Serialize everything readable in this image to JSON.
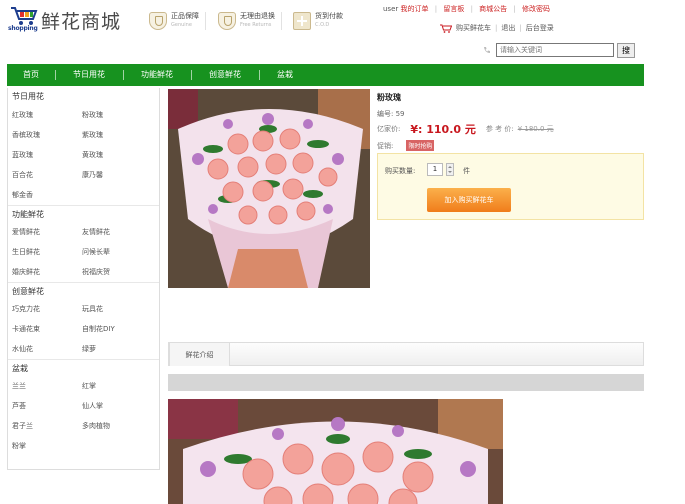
{
  "logo": {
    "title": "鲜花商城",
    "subtitle": "shopping"
  },
  "guarantees": [
    {
      "title": "正品保障",
      "subtitle": "Genuine"
    },
    {
      "title": "无理由退换",
      "subtitle": "Free Returns"
    },
    {
      "title": "货到付款",
      "subtitle": "C.O.D"
    }
  ],
  "top_links": {
    "user": "user",
    "my_orders": "我的订单",
    "message_board": "留言板",
    "mall_notice": "商城公告",
    "change_password": "修改密码"
  },
  "cart_line": {
    "cart": "购买鲜花车",
    "logout": "退出",
    "admin_login": "后台登录"
  },
  "search": {
    "placeholder": "请输入关键词",
    "button": "搜"
  },
  "nav": [
    "首页",
    "节日用花",
    "功能鲜花",
    "创意鲜花",
    "盆栽"
  ],
  "sidebar": [
    {
      "title": "节日用花",
      "items": [
        "红玫瑰",
        "粉玫瑰",
        "香槟玫瑰",
        "紫玫瑰",
        "蓝玫瑰",
        "黄玫瑰",
        "百合花",
        "康乃馨",
        "郁金香"
      ]
    },
    {
      "title": "功能鲜花",
      "items": [
        "爱情鲜花",
        "友情鲜花",
        "生日鲜花",
        "问候长辈",
        "婚庆鲜花",
        "祝福庆贺"
      ]
    },
    {
      "title": "创意鲜花",
      "items": [
        "巧克力花",
        "玩具花",
        "卡通花束",
        "自制花DIY",
        "水仙花",
        "绿萝"
      ]
    },
    {
      "title": "盆栽",
      "items": [
        "兰兰",
        "红掌",
        "芦荟",
        "仙人掌",
        "君子兰",
        "多肉植物",
        "粉掌"
      ]
    }
  ],
  "product": {
    "name": "粉玫瑰",
    "number_label": "编号:",
    "number": "59",
    "price_label": "亿家价:",
    "price": "¥: 110.0 元",
    "market_label": "参 考 价:",
    "market_price": "¥ 180.0 元",
    "promo_label": "促销:",
    "promo_tag": "限时抢购",
    "qty_label": "购买数量:",
    "qty": "1",
    "qty_unit": "件",
    "buy_button": "加入购买鲜花车"
  },
  "tabs": {
    "intro": "鲜花介绍"
  },
  "colors": {
    "nav_green": "#17921f",
    "price_red": "#c8171e",
    "buy_orange": "#f07d1b",
    "buybox_bg": "#fefbe4"
  }
}
